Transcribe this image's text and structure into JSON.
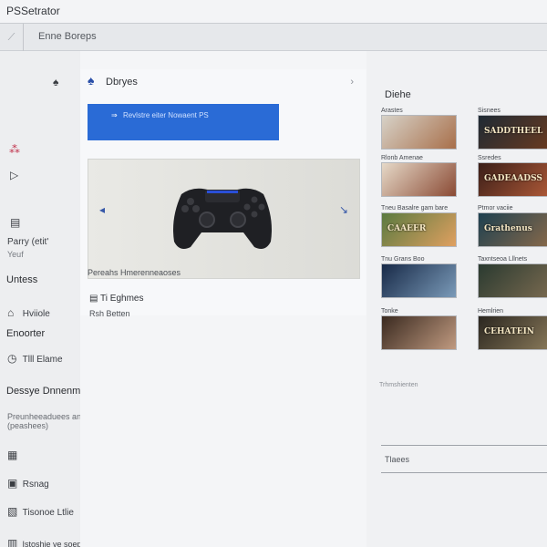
{
  "window": {
    "title": "PSSetrator"
  },
  "address_bar": {
    "icon": "link-icon",
    "text": "Enne Boreps"
  },
  "sidebar": {
    "items": [
      {
        "icon": "playstation-icon",
        "label": ""
      },
      {
        "icon": "game-icon",
        "label": ""
      },
      {
        "icon": "play-icon",
        "label": ""
      },
      {
        "icon": "save-icon",
        "label": ""
      },
      {
        "label": "Parry (etit'",
        "sublabel": "Yeuf"
      },
      {
        "icon": "home-icon",
        "label": "Hviiole"
      },
      {
        "icon": "clock-icon",
        "label": "Tlll Elame"
      },
      {
        "icon": "tool-icon",
        "label": ""
      },
      {
        "icon": "user-icon",
        "label": "Rsnag"
      },
      {
        "icon": "library-icon",
        "label": "Tisonoe Ltlie"
      },
      {
        "icon": "document-icon",
        "label": "Istoshie ve soepe bt"
      }
    ],
    "headings": [
      "Untess",
      "Enoorter",
      "Dessye Dnnenm"
    ],
    "description": [
      "Preunheeaduees and Amreyte Boend Atems",
      "(peashees)"
    ]
  },
  "center": {
    "panel_title": "Dbryes",
    "banner_text": "Revlstre eiter Nowaent PS",
    "below_hero": "Pereahs Hmerenneaoses",
    "feature_title": "Ti Eghmes",
    "feature_sub": "Rsh Betten"
  },
  "right": {
    "title": "Diehe",
    "thumbs": [
      {
        "label": "Arastes",
        "title": "",
        "colors": [
          "#d7d2c8",
          "#a86f4a"
        ]
      },
      {
        "label": "Sisnees",
        "title": "SADDTHEEL",
        "colors": [
          "#1e2a34",
          "#6b3b20"
        ]
      },
      {
        "label": "Rlonb Amenae",
        "title": "",
        "colors": [
          "#e6d9c8",
          "#8a4a34"
        ]
      },
      {
        "label": "Ssredes",
        "title": "GADEAADSS",
        "colors": [
          "#3a1e18",
          "#b05a38"
        ]
      },
      {
        "label": "Tneu Basalre gam bare",
        "title": "CAAEER",
        "colors": [
          "#5a7a40",
          "#e0a060"
        ]
      },
      {
        "label": "Ptmor vaciie",
        "title": "Grathenus",
        "colors": [
          "#1d4050",
          "#8a6a4a"
        ]
      },
      {
        "label": "Tnu Grans Boo",
        "title": "",
        "colors": [
          "#182a48",
          "#7a9ab8"
        ]
      },
      {
        "label": "Taxntseoa Lllnets",
        "title": "",
        "colors": [
          "#2a3a30",
          "#7a6a50"
        ]
      },
      {
        "label": "Tonke",
        "title": "",
        "colors": [
          "#3a2a20",
          "#c09a80"
        ]
      },
      {
        "label": "Hemlrien",
        "title": "CEHATEIN",
        "colors": [
          "#2a2620",
          "#8a7a5a"
        ]
      }
    ],
    "mini_label": "Trhmshienten",
    "footer_label": "Tlaees"
  },
  "brand_color": "#2a6bd6"
}
